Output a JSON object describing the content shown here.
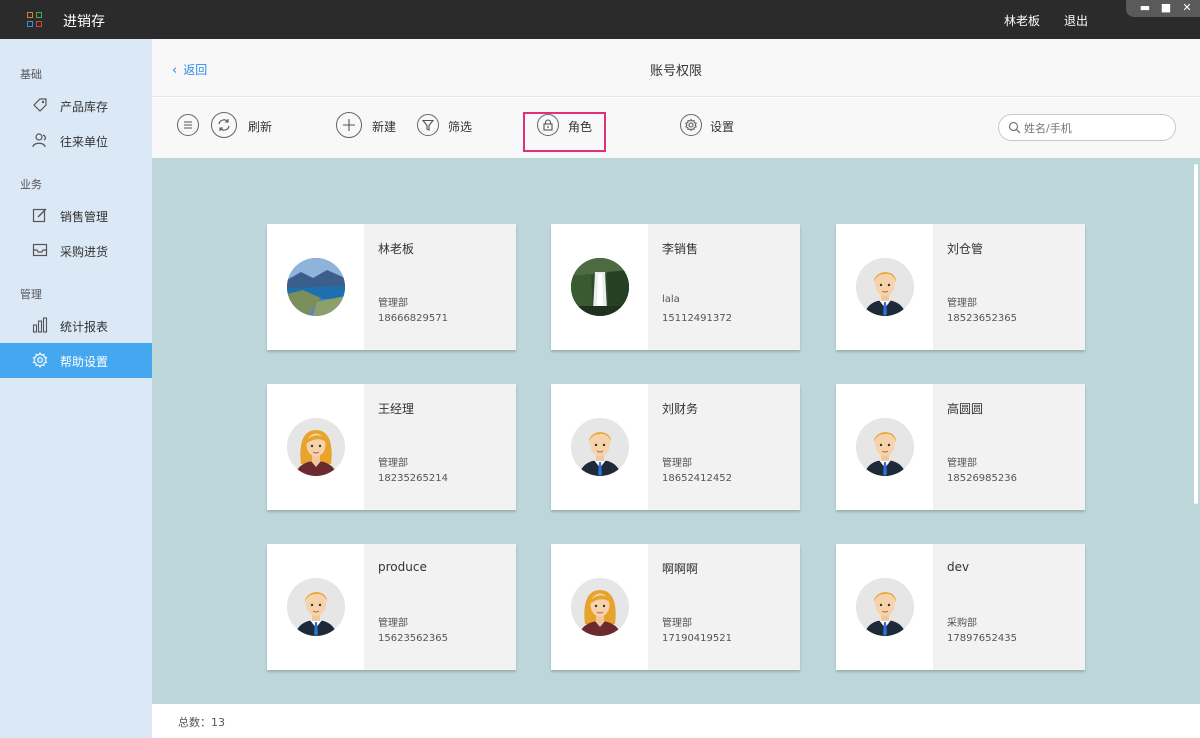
{
  "titlebar": {
    "app_title": "进销存",
    "user": "林老板",
    "logout": "退出",
    "logo_icon": "app-grid-icon"
  },
  "sidebar": {
    "sections": [
      {
        "title": "基础",
        "items": [
          {
            "label": "产品库存",
            "icon": "tag-icon"
          },
          {
            "label": "往来单位",
            "icon": "contacts-icon"
          }
        ]
      },
      {
        "title": "业务",
        "items": [
          {
            "label": "销售管理",
            "icon": "edit-icon"
          },
          {
            "label": "采购进货",
            "icon": "inbox-icon"
          }
        ]
      },
      {
        "title": "管理",
        "items": [
          {
            "label": "统计报表",
            "icon": "bar-chart-icon"
          },
          {
            "label": "帮助设置",
            "icon": "gear-icon",
            "active": true
          }
        ]
      }
    ]
  },
  "header": {
    "back_label": "返回",
    "title": "账号权限"
  },
  "toolbar": {
    "refresh": "刷新",
    "new": "新建",
    "filter": "筛选",
    "role": "角色",
    "settings": "设置",
    "search_placeholder": "姓名/手机"
  },
  "cards": [
    {
      "name": "林老板",
      "dept": "管理部",
      "phone": "18666829571",
      "avatar": "lake-photo"
    },
    {
      "name": "李销售",
      "dept": "lala",
      "phone": "15112491372",
      "avatar": "waterfall-photo"
    },
    {
      "name": "刘仓管",
      "dept": "管理部",
      "phone": "18523652365",
      "avatar": "male-avatar"
    },
    {
      "name": "王经理",
      "dept": "管理部",
      "phone": "18235265214",
      "avatar": "female-avatar"
    },
    {
      "name": "刘财务",
      "dept": "管理部",
      "phone": "18652412452",
      "avatar": "male-avatar"
    },
    {
      "name": "高圆圆",
      "dept": "管理部",
      "phone": "18526985236",
      "avatar": "male-avatar"
    },
    {
      "name": "produce",
      "dept": "管理部",
      "phone": "15623562365",
      "avatar": "male-avatar"
    },
    {
      "name": "啊啊啊",
      "dept": "管理部",
      "phone": "17190419521",
      "avatar": "female-avatar"
    },
    {
      "name": "dev",
      "dept": "采购部",
      "phone": "17897652435",
      "avatar": "male-avatar"
    }
  ],
  "footer": {
    "total_label": "总数：",
    "total_value": "13",
    "total_text": "总数：13"
  },
  "colors": {
    "titlebar": "#2b2b2b",
    "sidebar": "#dbe8f5",
    "active": "#45a7f0",
    "content_bg": "#bdd6d9",
    "highlight": "#e0307a",
    "link": "#2f8ce8"
  }
}
